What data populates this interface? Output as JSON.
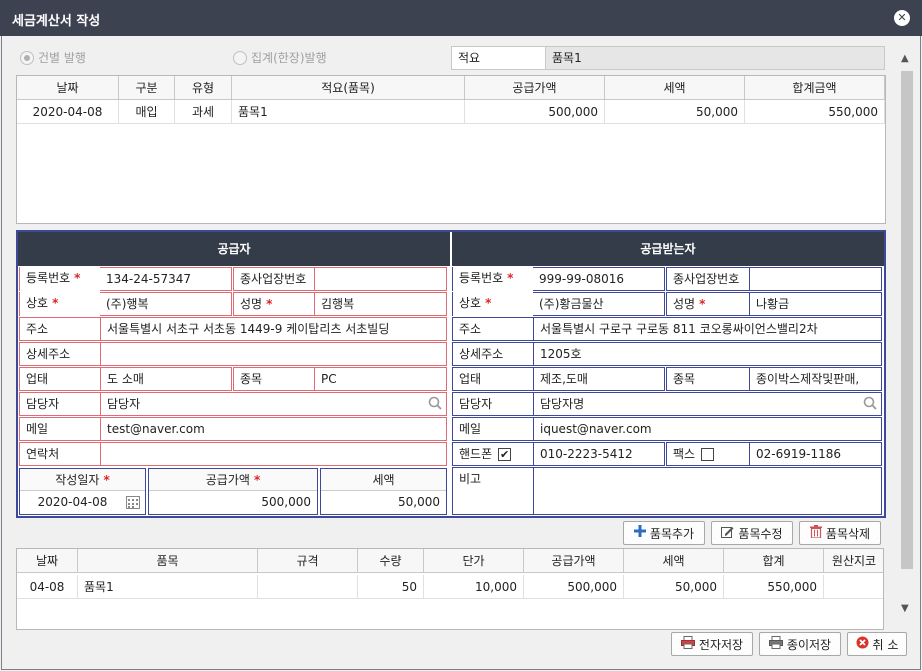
{
  "window": {
    "title": "세금계산서 작성",
    "close": "✕"
  },
  "options": {
    "single": "건별 발행",
    "batch": "집계(한장)발행",
    "memo_label": "적요",
    "memo_value": "품목1"
  },
  "top_grid": {
    "headers": [
      "날짜",
      "구분",
      "유형",
      "적요(품목)",
      "공급가액",
      "세액",
      "합계금액"
    ],
    "rows": [
      [
        "2020-04-08",
        "매입",
        "과세",
        "품목1",
        "500,000",
        "50,000",
        "550,000"
      ]
    ]
  },
  "supplier": {
    "title": "공급자",
    "reg_no_label": "등록번호",
    "reg_no": "134-24-57347",
    "sub_biz_label": "종사업장번호",
    "sub_biz": "",
    "name_label": "상호",
    "name": "(주)행복",
    "rep_label": "성명",
    "rep": "김행복",
    "addr_label": "주소",
    "addr": "서울특별시 서초구 서초동 1449-9 케이탑리츠 서초빌딩",
    "addr2_label": "상세주소",
    "addr2": "",
    "type_label": "업태",
    "type": "도 소매",
    "item_label": "종목",
    "item": "PC",
    "contact_label": "담당자",
    "contact": "담당자",
    "email_label": "메일",
    "email": "test@naver.com",
    "phone_label": "연락처",
    "phone": ""
  },
  "receiver": {
    "title": "공급받는자",
    "reg_no_label": "등록번호",
    "reg_no": "999-99-08016",
    "sub_biz_label": "종사업장번호",
    "sub_biz": "",
    "name_label": "상호",
    "name": "(주)황금물산",
    "rep_label": "성명",
    "rep": "나황금",
    "addr_label": "주소",
    "addr": "서울특별시 구로구 구로동 811 코오롱싸이언스밸리2차",
    "addr2_label": "상세주소",
    "addr2": "1205호",
    "type_label": "업태",
    "type": "제조,도매",
    "item_label": "종목",
    "item": "종이박스제작및판매,",
    "contact_label": "담당자",
    "contact": "담당자명",
    "email_label": "메일",
    "email": "iquest@naver.com",
    "mobile_label": "핸드폰",
    "mobile": "010-2223-5412",
    "fax_label": "팩스",
    "fax": "02-6919-1186",
    "note_label": "비고",
    "note": ""
  },
  "summary": {
    "date_label": "작성일자",
    "date": "2020-04-08",
    "supply_label": "공급가액",
    "supply": "500,000",
    "tax_label": "세액",
    "tax": "50,000"
  },
  "item_buttons": {
    "add": "품목추가",
    "edit": "품목수정",
    "delete": "품목삭제"
  },
  "item_grid": {
    "headers": [
      "날짜",
      "품목",
      "규격",
      "수량",
      "단가",
      "공급가액",
      "세액",
      "합계",
      "원산지코"
    ],
    "rows": [
      [
        "04-08",
        "품목1",
        "",
        "50",
        "10,000",
        "500,000",
        "50,000",
        "550,000",
        ""
      ]
    ]
  },
  "footer": {
    "e_save": "전자저장",
    "paper_save": "종이저장",
    "cancel": "취 소"
  },
  "check": "✔"
}
